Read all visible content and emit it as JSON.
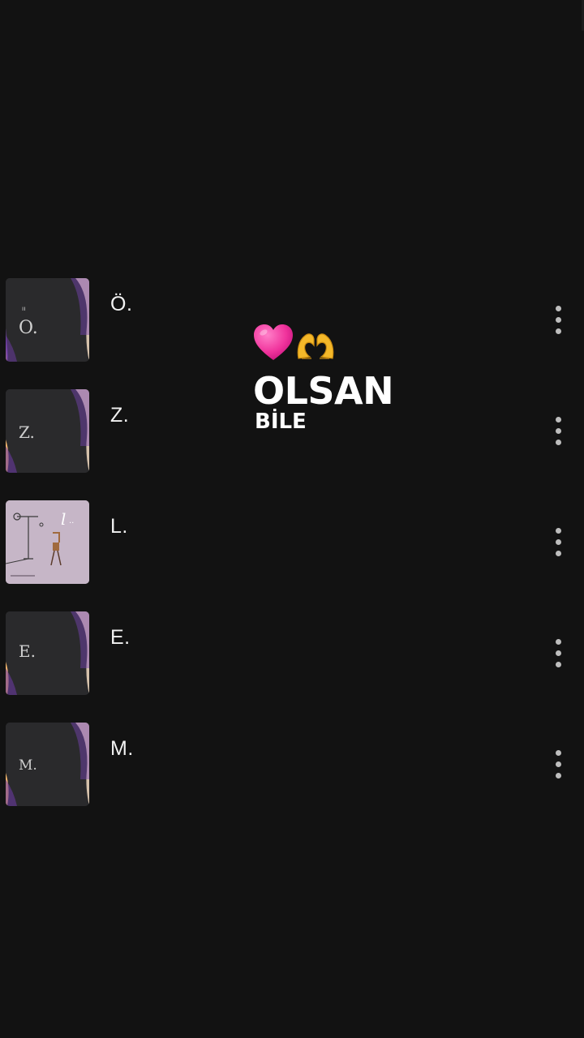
{
  "tracks": [
    {
      "title": "Ö.",
      "cover_letter": "Ö"
    },
    {
      "title": "Z.",
      "cover_letter": "Z."
    },
    {
      "title": "L.",
      "cover_letter": "L."
    },
    {
      "title": "E.",
      "cover_letter": "E."
    },
    {
      "title": "M.",
      "cover_letter": "M."
    }
  ],
  "overlay": {
    "emoji": [
      "heart-emoji",
      "heart-hands-emoji"
    ],
    "title": "OLSAN",
    "subtitle": "BİLE"
  },
  "colors": {
    "background": "#121212",
    "text": "#f2f2f2",
    "more_dots": "#bdbdbd",
    "heart": "#f0339c",
    "hands": "#f4b829",
    "cover_dark": "#2a2a2c",
    "cover_light": "#c6b6c7"
  }
}
